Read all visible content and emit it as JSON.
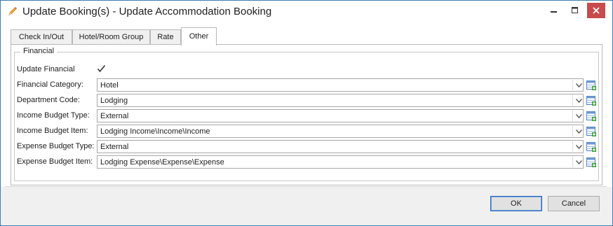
{
  "window": {
    "title": "Update Booking(s) - Update Accommodation Booking",
    "title_icon": "pencil-icon"
  },
  "tabs": [
    {
      "label": "Check In/Out"
    },
    {
      "label": "Hotel/Room Group"
    },
    {
      "label": "Rate"
    },
    {
      "label": "Other",
      "active": true
    }
  ],
  "financial": {
    "group_label": "Financial",
    "update_financial": {
      "label": "Update Financial",
      "checked": true
    },
    "fields": [
      {
        "label": "Financial Category:",
        "value": "Hotel"
      },
      {
        "label": "Department Code:",
        "value": "Lodging"
      },
      {
        "label": "Income Budget Type:",
        "value": "External"
      },
      {
        "label": "Income Budget Item:",
        "value": "Lodging Income\\Income\\Income"
      },
      {
        "label": "Expense Budget Type:",
        "value": "External"
      },
      {
        "label": "Expense Budget Item:",
        "value": "Lodging Expense\\Expense\\Expense"
      }
    ]
  },
  "buttons": {
    "ok": "OK",
    "cancel": "Cancel"
  },
  "colors": {
    "window_border": "#3c7fb1",
    "close_button": "#c74b4b",
    "default_button_border": "#2b6bbd"
  }
}
